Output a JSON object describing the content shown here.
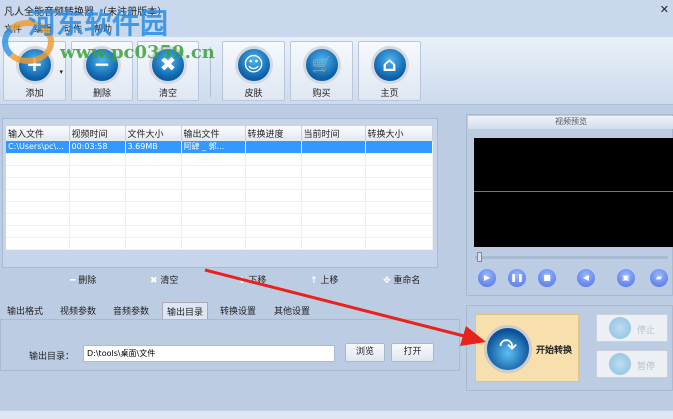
{
  "title": "凡人全能音频转换器 （未注册版本）",
  "menu": [
    "文件",
    "编辑",
    "动作",
    "帮助"
  ],
  "watermark": {
    "name": "河东软件园",
    "url": "www.pc0359.cn"
  },
  "toolbar": [
    {
      "label": "添加",
      "icon": "plus-icon",
      "glyph": "+"
    },
    {
      "label": "删除",
      "icon": "minus-icon",
      "glyph": "−"
    },
    {
      "label": "清空",
      "icon": "clear-x-icon",
      "glyph": "✖"
    },
    {
      "label": "皮肤",
      "icon": "smiley-icon",
      "glyph": "☺"
    },
    {
      "label": "购买",
      "icon": "cart-icon",
      "glyph": "🛒"
    },
    {
      "label": "主页",
      "icon": "home-icon",
      "glyph": "⌂"
    }
  ],
  "table": {
    "columns": [
      "输入文件",
      "视频时间",
      "文件大小",
      "输出文件",
      "转换进度",
      "当前时间",
      "转换大小"
    ],
    "rows": [
      [
        "C:\\Users\\pc\\...",
        "00:03:58",
        "3.69MB",
        "阿肆 _ 郭...",
        "",
        "",
        ""
      ]
    ]
  },
  "list_actions": [
    "删除",
    "清空",
    "下移",
    "上移",
    "重命名"
  ],
  "tabs": [
    "输出格式",
    "视频参数",
    "音频参数",
    "输出目录",
    "转换设置",
    "其他设置"
  ],
  "active_tab": "输出目录",
  "output": {
    "label": "输出目录：",
    "value": "D:\\tools\\桌面\\文件",
    "browse": "浏览",
    "open": "打开"
  },
  "preview": {
    "title": "视频预览",
    "position": 0
  },
  "controls": {
    "start": "开始转换",
    "stop": "停止",
    "pause": "暂停"
  },
  "colors": {
    "selection": "#3399ff",
    "start_bg": "#f7dfae",
    "annotation_arrow": "#e8231b"
  }
}
